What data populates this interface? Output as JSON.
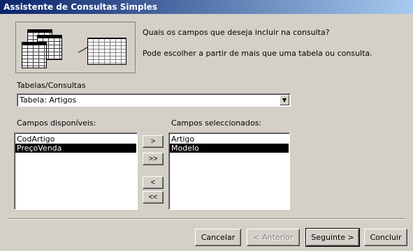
{
  "window": {
    "title": "Assistente de Consultas Simples"
  },
  "intro": {
    "question": "Quais os campos que deseja incluir na consulta?",
    "hint": "Pode escolher a partir de mais que uma tabela ou consulta."
  },
  "tables": {
    "label": "Tabelas/Consultas",
    "selected": "Tabela: Artigos"
  },
  "available": {
    "label": "Campos disponíveis:",
    "items": [
      "CodArtigo",
      "PreçoVenda"
    ],
    "selected_index": 1
  },
  "chosen": {
    "label": "Campos seleccionados:",
    "items": [
      "Artigo",
      "Modelo"
    ],
    "selected_index": 1
  },
  "move": {
    "add_one": ">",
    "add_all": ">>",
    "remove_one": "<",
    "remove_all": "<<"
  },
  "buttons": {
    "cancel": "Cancelar",
    "back": "< Anterior",
    "next": "Seguinte >",
    "finish": "Concluir"
  }
}
